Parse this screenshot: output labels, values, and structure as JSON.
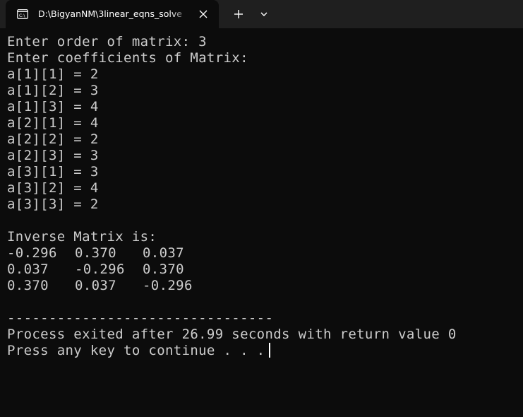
{
  "tab": {
    "title": "D:\\BigyanNM\\3linear_eqns_solve"
  },
  "icons": {
    "tab": "terminal-icon",
    "close": "close-icon",
    "new_tab": "plus-icon",
    "dropdown": "chevron-down-icon"
  },
  "colors": {
    "background": "#0c0c0c",
    "tabstrip": "#1f1f1f",
    "text": "#cccccc"
  },
  "console": {
    "prompt_order": "Enter order of matrix: 3",
    "prompt_coeff": "Enter coefficients of Matrix:",
    "entries": [
      "a[1][1] = 2",
      "a[1][2] = 3",
      "a[1][3] = 4",
      "a[2][1] = 4",
      "a[2][2] = 2",
      "a[2][3] = 3",
      "a[3][1] = 3",
      "a[3][2] = 4",
      "a[3][3] = 2"
    ],
    "inverse_header": "Inverse Matrix is:",
    "inverse": [
      [
        "-0.296",
        "0.370",
        "0.037"
      ],
      [
        "0.037",
        "-0.296",
        "0.370"
      ],
      [
        "0.370",
        "0.037",
        "-0.296"
      ]
    ],
    "separator": "--------------------------------",
    "exit_message": "Process exited after 26.99 seconds with return value 0",
    "continue_prompt": "Press any key to continue . . ."
  }
}
